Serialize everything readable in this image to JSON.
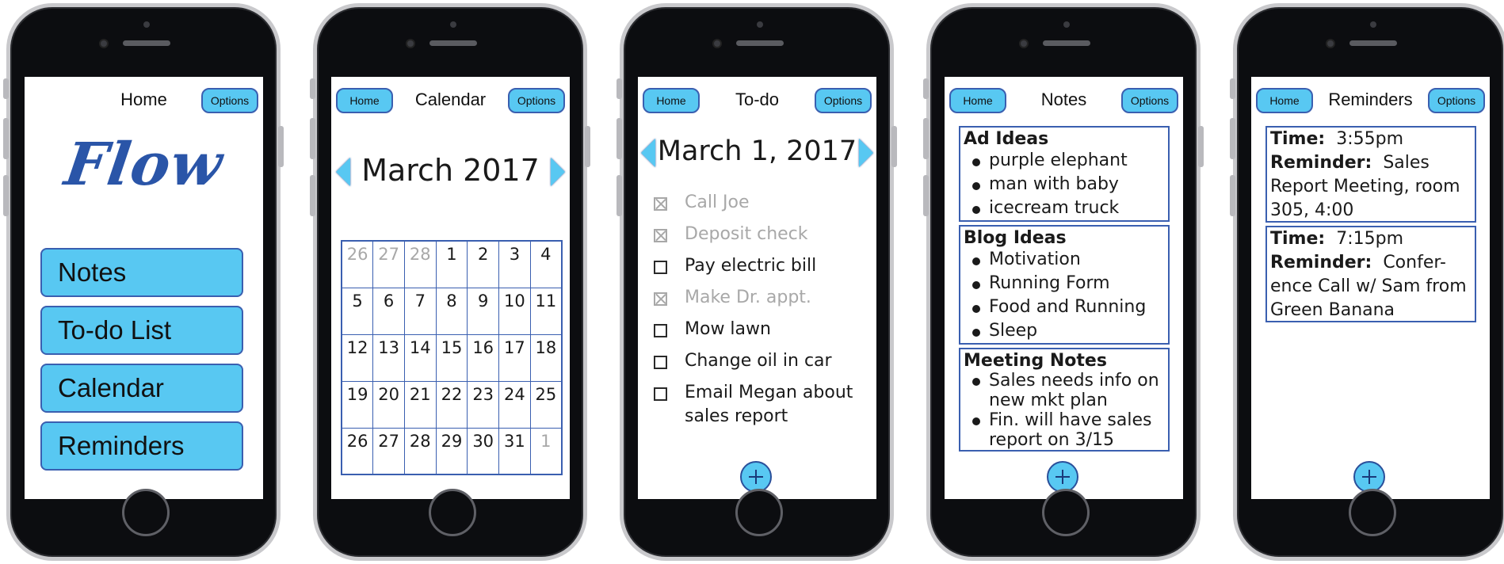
{
  "colors": {
    "accent": "#58c8f2",
    "border": "#3a5fb0",
    "logo": "#2a55a8",
    "muted": "#a8a8a8"
  },
  "home_screen": {
    "title": "Home",
    "options_label": "Options",
    "logo": "Flow",
    "menu": [
      {
        "label": "Notes"
      },
      {
        "label": "To-do List"
      },
      {
        "label": "Calendar"
      },
      {
        "label": "Reminders"
      }
    ]
  },
  "calendar_screen": {
    "home_label": "Home",
    "title": "Calendar",
    "options_label": "Options",
    "month": "March 2017",
    "weeks": [
      [
        "26",
        "27",
        "28",
        "1",
        "2",
        "3",
        "4"
      ],
      [
        "5",
        "6",
        "7",
        "8",
        "9",
        "10",
        "11"
      ],
      [
        "12",
        "13",
        "14",
        "15",
        "16",
        "17",
        "18"
      ],
      [
        "19",
        "20",
        "21",
        "22",
        "23",
        "24",
        "25"
      ],
      [
        "26",
        "27",
        "28",
        "29",
        "30",
        "31",
        "1"
      ]
    ],
    "muted_cells": [
      "0-0",
      "0-1",
      "0-2",
      "4-6"
    ]
  },
  "todo_screen": {
    "home_label": "Home",
    "title": "To-do",
    "options_label": "Options",
    "date": "March 1, 2017",
    "items": [
      {
        "text": "Call Joe",
        "done": true
      },
      {
        "text": "Deposit check",
        "done": true
      },
      {
        "text": "Pay electric bill",
        "done": false
      },
      {
        "text": "Make Dr. appt.",
        "done": true
      },
      {
        "text": "Mow lawn",
        "done": false
      },
      {
        "text": "Change oil in car",
        "done": false
      },
      {
        "text": "Email Megan about sales report",
        "done": false
      }
    ]
  },
  "notes_screen": {
    "home_label": "Home",
    "title": "Notes",
    "options_label": "Options",
    "notes": [
      {
        "title": "Ad Ideas",
        "items": [
          "purple elephant",
          "man with baby",
          "icecream truck"
        ]
      },
      {
        "title": "Blog Ideas",
        "items": [
          "Motivation",
          "Running Form",
          "Food and Running",
          "Sleep"
        ]
      },
      {
        "title": "Meeting Notes",
        "items": [
          "Sales needs info on new mkt plan",
          "Fin. will have sales report on 3/15"
        ]
      }
    ]
  },
  "reminders_screen": {
    "home_label": "Home",
    "title": "Reminders",
    "options_label": "Options",
    "time_label": "Time:",
    "reminder_label": "Reminder:",
    "reminders": [
      {
        "time": "3:55pm",
        "text": "Sales Report Meeting, room 305, 4:00"
      },
      {
        "time": "7:15pm",
        "text": "Confer-ence Call w/  Sam from Green Banana"
      }
    ]
  }
}
